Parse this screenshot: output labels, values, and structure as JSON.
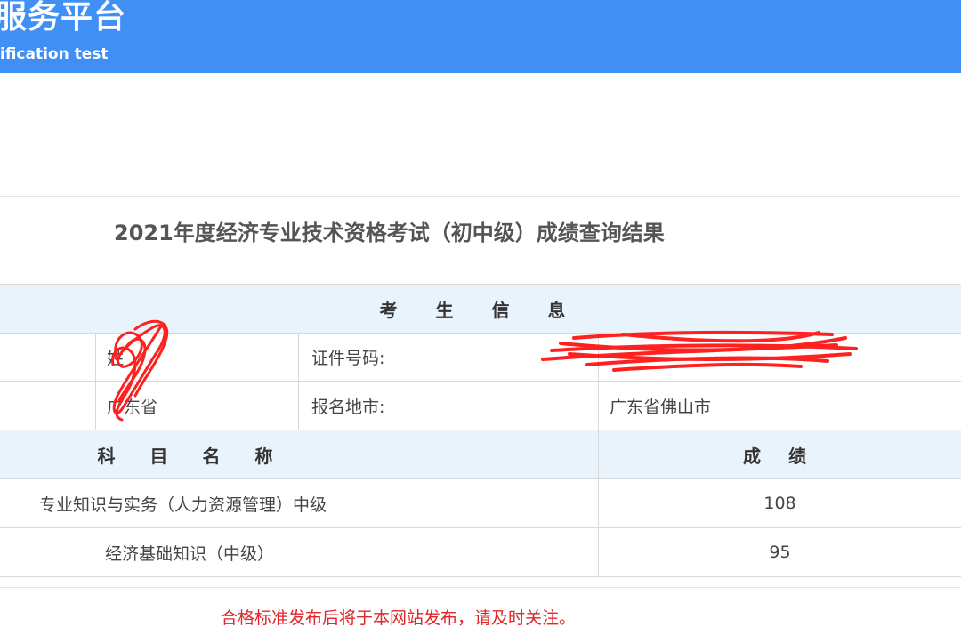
{
  "header": {
    "title": "服务平台",
    "subtitle": "ification test"
  },
  "result": {
    "title": "2021年度经济专业技术资格考试（初中级）成绩查询结果"
  },
  "candidate_info": {
    "section_label": "考 生 信 息",
    "row1": {
      "label_left": "姓",
      "value_left": "",
      "label_right": "证件号码:",
      "value_right": ""
    },
    "row2": {
      "value_left": "广东省",
      "label_right": "报名地市:",
      "value_right": "广东省佛山市"
    }
  },
  "scores": {
    "subject_header": "科 目 名 称",
    "score_header": "成 绩",
    "rows": [
      {
        "subject": "专业知识与实务（人力资源管理）中级",
        "score": "108"
      },
      {
        "subject": "经济基础知识（中级）",
        "score": "95"
      }
    ]
  },
  "notice": "合格标准发布后将于本网站发布，请及时关注。",
  "colors": {
    "header_bg": "#3f8ff5",
    "table_head_bg": "#e9f3fb",
    "notice_red": "#e0262a",
    "scribble_red": "#ff2020"
  }
}
